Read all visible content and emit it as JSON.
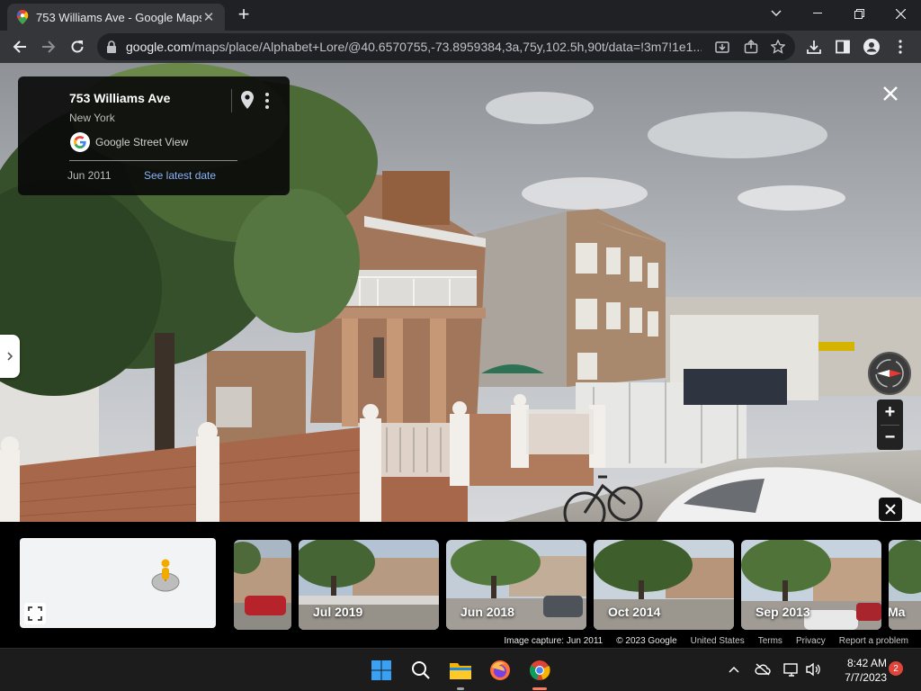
{
  "browser": {
    "tab_title": "753 Williams Ave - Google Maps",
    "url_host": "google.com",
    "url_path": "/maps/place/Alphabet+Lore/@40.6570755,-73.8959384,3a,75y,102.5h,90t/data=!3m7!1e1..."
  },
  "infocard": {
    "title": "753 Williams Ave",
    "subtitle": "New York",
    "provider": "Google Street View",
    "date": "Jun 2011",
    "latest_link": "See latest date"
  },
  "filmstrip": {
    "thumbs": [
      {
        "label": ""
      },
      {
        "label": "Jul 2019"
      },
      {
        "label": "Jun 2018"
      },
      {
        "label": "Oct 2014"
      },
      {
        "label": "Sep 2013"
      },
      {
        "label": "Ma"
      }
    ]
  },
  "footer": {
    "capture": "Image capture: Jun 2011",
    "copyright": "© 2023 Google",
    "region": "United States",
    "terms": "Terms",
    "privacy": "Privacy",
    "report": "Report a problem"
  },
  "taskbar": {
    "time": "8:42 AM",
    "date": "7/7/2023",
    "notifications": "2"
  },
  "zoom": {
    "plus": "+",
    "minus": "−"
  }
}
